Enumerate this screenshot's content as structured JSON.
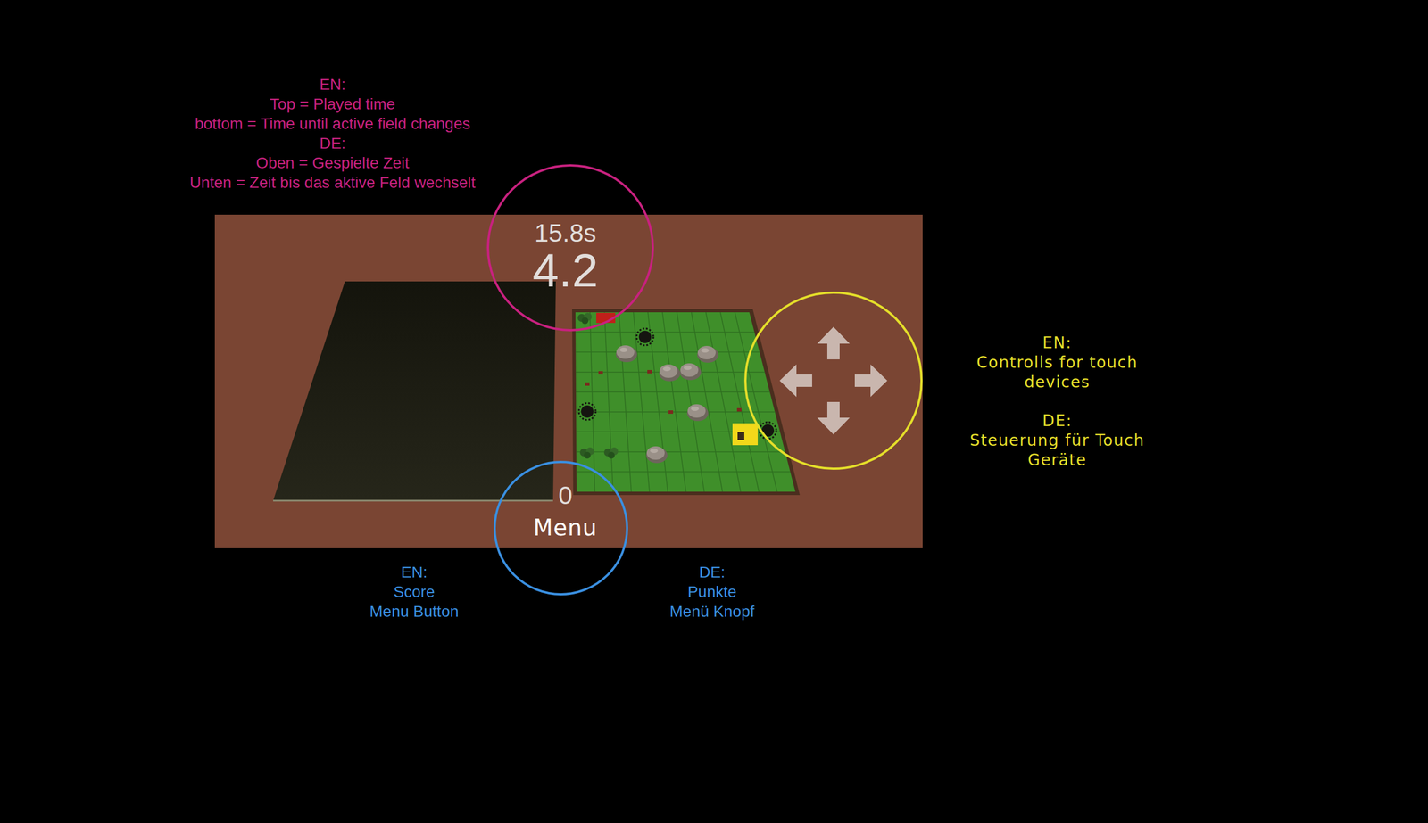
{
  "annotations": [
    {
      "name": "timers",
      "color": "#c8217f",
      "blocks": [
        {
          "lines": [
            "EN:",
            "Top = Played time",
            "bottom = Time until active field changes",
            "DE:",
            "Oben = Gespielte Zeit",
            "Unten = Zeit bis das aktive Feld wechselt"
          ]
        }
      ]
    },
    {
      "name": "touch-controls",
      "color": "#e4de2a",
      "blocks": [
        {
          "lines": [
            "EN:",
            "Controlls for touch",
            "devices"
          ]
        },
        {
          "lines": [
            "DE:",
            "Steuerung für Touch",
            "Geräte"
          ]
        }
      ]
    },
    {
      "name": "score-menu",
      "color": "#3a8fe0",
      "blocks": [
        {
          "lines": [
            "EN:",
            "Score",
            "Menu Button"
          ]
        },
        {
          "lines": [
            "DE:",
            "Punkte",
            "Menü Knopf"
          ]
        }
      ]
    }
  ],
  "hud": {
    "played_time": "15.8s",
    "field_timer": "4.2",
    "score": "0",
    "menu_button": "Menu"
  }
}
